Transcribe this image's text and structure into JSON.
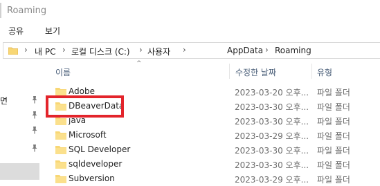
{
  "window": {
    "title": "Roaming"
  },
  "ribbon": {
    "tabs": [
      "공유",
      "보기"
    ]
  },
  "address": {
    "separator": "›",
    "crumbs": [
      "내 PC",
      "로컬 디스크 (C:)",
      "사용자",
      "AppData",
      "Roaming"
    ]
  },
  "nav": {
    "items": [
      "면",
      "",
      "",
      "",
      ""
    ]
  },
  "columns": {
    "name": "이름",
    "date": "수정한 날짜",
    "type": "유형",
    "sort_indicator": "^"
  },
  "files": [
    {
      "name": "Adobe",
      "date": "2023-03-20 오후...",
      "type": "파일 폴더"
    },
    {
      "name": "DBeaverData",
      "date": "2023-03-30 오후...",
      "type": "파일 폴더"
    },
    {
      "name": "java",
      "date": "2023-03-30 오후...",
      "type": "파일 폴더"
    },
    {
      "name": "Microsoft",
      "date": "2023-03-29 오후...",
      "type": "파일 폴더"
    },
    {
      "name": "SQL Developer",
      "date": "2023-03-30 오후...",
      "type": "파일 폴더"
    },
    {
      "name": "sqldeveloper",
      "date": "2023-03-30 오후...",
      "type": "파일 폴더"
    },
    {
      "name": "Subversion",
      "date": "2023-03-29 오후...",
      "type": "파일 폴더"
    }
  ],
  "highlight": {
    "target": "DBeaverData",
    "color": "#e3242b"
  },
  "colors": {
    "folder": "#f8d775",
    "folder_dark": "#e8b84a",
    "header_text": "#4c607a"
  }
}
